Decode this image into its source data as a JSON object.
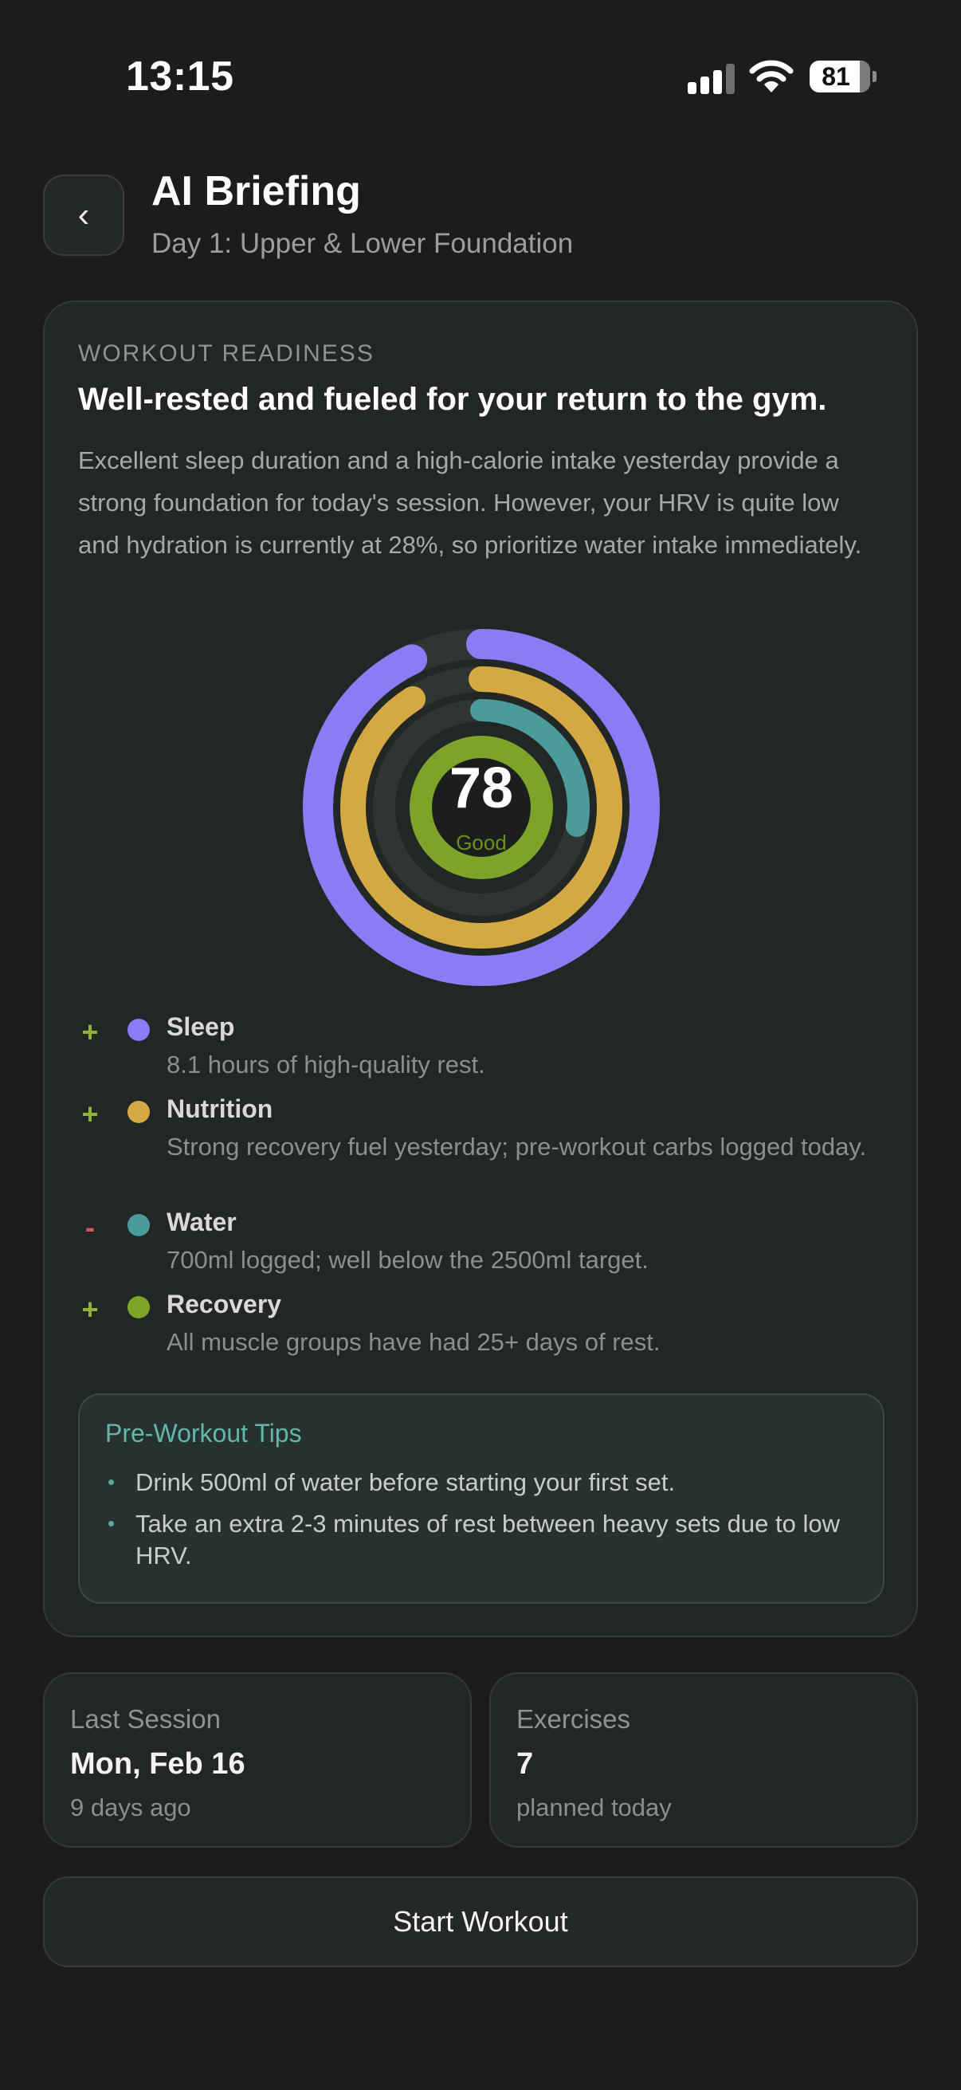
{
  "status_bar": {
    "time": "13:15",
    "battery": "81",
    "battery_level": 0.81
  },
  "header": {
    "back_glyph": "‹",
    "title": "AI Briefing",
    "subtitle": "Day 1: Upper & Lower Foundation"
  },
  "readiness": {
    "eyebrow": "WORKOUT READINESS",
    "headline": "Well-rested and fueled for your return to the gym.",
    "description": "Excellent sleep duration and a high-calorie intake yesterday provide a strong foundation for today's session. However, your HRV is quite low and hydration is currently at 28%, so prioritize water intake immediately.",
    "score": "78",
    "score_label": "Good",
    "rings": [
      {
        "name": "Sleep",
        "fraction": 0.93,
        "color": "#8b7cf6"
      },
      {
        "name": "Nutrition",
        "fraction": 0.91,
        "color": "#d4a843"
      },
      {
        "name": "Water",
        "fraction": 0.28,
        "color": "#4a9c9c"
      },
      {
        "name": "Recovery",
        "fraction": 1.0,
        "color": "#7da428"
      }
    ],
    "factors": [
      {
        "sign": "+",
        "name": "Sleep",
        "detail": "8.1 hours of high-quality rest.",
        "color": "#8b7cf6"
      },
      {
        "sign": "+",
        "name": "Nutrition",
        "detail": "Strong recovery fuel yesterday; pre-workout carbs logged today.",
        "color": "#d4a843"
      },
      {
        "sign": "-",
        "name": "Water",
        "detail": "700ml logged; well below the 2500ml target.",
        "color": "#4a9c9c"
      },
      {
        "sign": "+",
        "name": "Recovery",
        "detail": "All muscle groups have had 25+ days of rest.",
        "color": "#7da428"
      }
    ],
    "tips": {
      "title": "Pre-Workout Tips",
      "items": [
        "Drink 500ml of water before starting your first set.",
        "Take an extra 2-3 minutes of rest between heavy sets due to low HRV."
      ]
    }
  },
  "stats": {
    "last_session": {
      "label": "Last Session",
      "value": "Mon, Feb 16",
      "sub": "9 days ago"
    },
    "exercises": {
      "label": "Exercises",
      "value": "7",
      "sub": "planned today"
    }
  },
  "cta": {
    "label": "Start Workout"
  }
}
